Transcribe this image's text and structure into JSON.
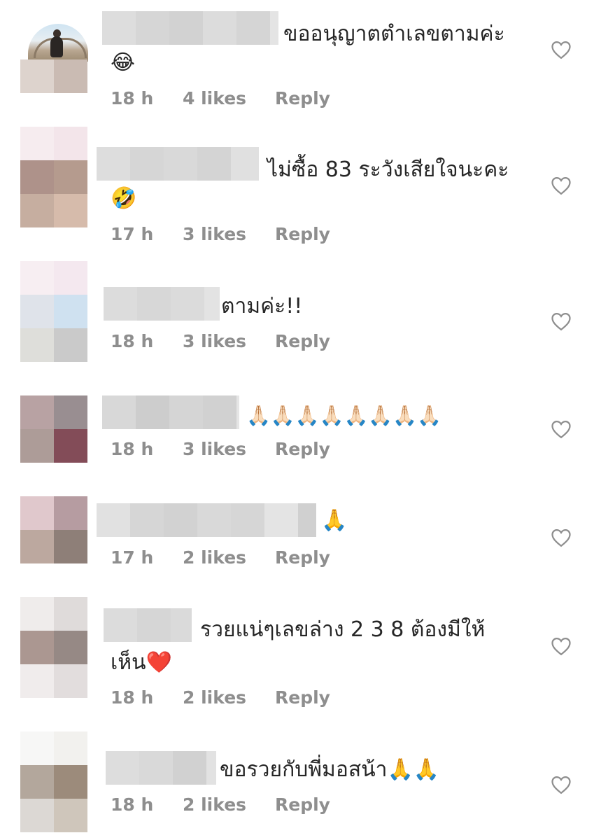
{
  "comments": [
    {
      "text": "ขออนุญาตตำเลขตามค่ะ",
      "emoji": "😂",
      "time": "18 h",
      "likes": "4 likes",
      "reply": "Reply",
      "heart_icon": "heart-outline-icon"
    },
    {
      "text": "ไม่ซื้อ 83 ระวังเสียใจนะคะ",
      "emoji": "🤣",
      "time": "17 h",
      "likes": "3 likes",
      "reply": "Reply",
      "heart_icon": "heart-outline-icon"
    },
    {
      "text": "ตามค่ะ!!",
      "time": "18 h",
      "likes": "3 likes",
      "reply": "Reply",
      "heart_icon": "heart-outline-icon"
    },
    {
      "text": "🙏🏻🙏🏻🙏🏻🙏🏻🙏🏻🙏🏻🙏🏻🙏🏻",
      "time": "18 h",
      "likes": "3 likes",
      "reply": "Reply",
      "heart_icon": "heart-outline-icon"
    },
    {
      "text": "🙏",
      "time": "17 h",
      "likes": "2 likes",
      "reply": "Reply",
      "heart_icon": "heart-outline-icon"
    },
    {
      "text": "รวยแน่ๆเลขล่าง 2 3 8 ต้องมีให้",
      "text_line2": "เห็น❤️",
      "time": "18 h",
      "likes": "2 likes",
      "reply": "Reply",
      "heart_icon": "heart-outline-icon"
    },
    {
      "text": "ขอรวยกับพี่มอสน้า🙏🙏",
      "time": "18 h",
      "likes": "2 likes",
      "reply": "Reply",
      "heart_icon": "heart-outline-icon"
    }
  ]
}
